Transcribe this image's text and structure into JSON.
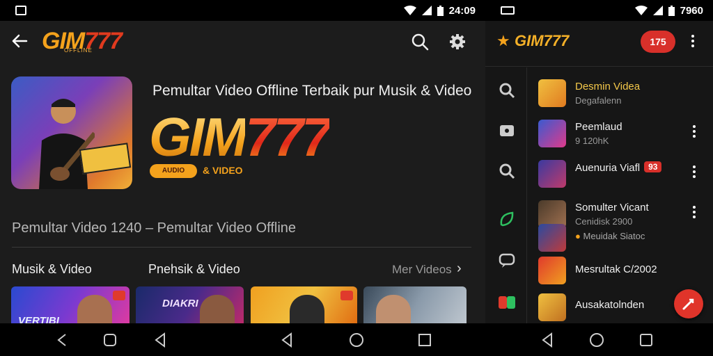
{
  "status_left": {
    "time": "24:09"
  },
  "status_right": {
    "time": "7960"
  },
  "left_app": {
    "logo_text_a": "GIM",
    "logo_text_b": "777",
    "logo_sub": "OFFLINE",
    "tagline": "Pemultar Video Offline Terbaik pur Musik & Video",
    "big_logo_a": "GIM",
    "big_logo_b": "777",
    "badge_text": "AUDIO",
    "badge_sub": "& VIDEO",
    "subtitle": "Pemultar Video 1240 – Pemultar Video Offline",
    "sections": [
      {
        "title": "Musik & Video"
      },
      {
        "title": "Pnehsik & Video"
      }
    ],
    "more_label": "Mer Videos",
    "thumbs": [
      {
        "text": "VERTIBI",
        "color1": "#2a4ad0",
        "color2": "#e03aa0"
      },
      {
        "text": "DIAKRI",
        "color1": "#1a2a6a",
        "color2": "#c02a6a"
      },
      {
        "text": "",
        "color1": "#f0a020",
        "color2": "#e06a10"
      },
      {
        "text": "",
        "color1": "#3a4a5a",
        "color2": "#c0c8d0"
      }
    ]
  },
  "right_app": {
    "logo_text": "GIM777",
    "pill_text": "175",
    "items": [
      {
        "title": "Desmin Videa",
        "meta": "Degafalenn",
        "title_color": "#f4c84a",
        "badge": ""
      },
      {
        "title": "Peemlaud",
        "meta": "9 120hK",
        "title_color": "#f0f0f0",
        "badge": ""
      },
      {
        "title": "Auenuria Viafl",
        "meta": "",
        "title_color": "#f0f0f0",
        "badge": "93"
      },
      {
        "title": "Somulter Vicant",
        "meta": "Cenidisk 2900",
        "title_color": "#f0f0f0",
        "badge": ""
      },
      {
        "title": "Mesrultak C/2002",
        "meta": "",
        "title_color": "#f0f0f0",
        "badge": ""
      },
      {
        "title": "Ausakatolnden",
        "meta": "",
        "title_color": "#f0f0f0",
        "badge": ""
      }
    ],
    "extra_meta": "Meuidak Siatoc"
  },
  "colors": {
    "accent_orange": "#f4a21c",
    "accent_red": "#d8302a",
    "background": "#1c1c1c"
  }
}
